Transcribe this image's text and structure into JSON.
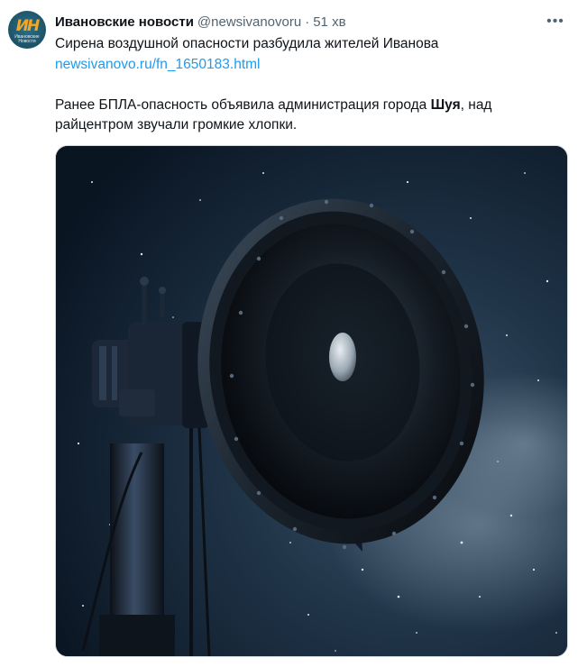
{
  "tweet": {
    "author_name": "Ивановские новости",
    "author_handle": "@newsivanovoru",
    "separator": "·",
    "time": "51 хв",
    "more_label": "•••",
    "avatar": {
      "logo_text": "ИН",
      "logo_sub": "Ивановские Новости"
    },
    "text": {
      "line1": "Сирена воздушной опасности разбудила жителей Иванова",
      "link": "newsivanovo.ru/fn_1650183.html",
      "para2_before": "Ранее БПЛА-опасность объявила администрация города ",
      "para2_bold": "Шуя",
      "para2_after": ", над райцентром звучали громкие хлопки."
    },
    "media": {
      "description_icon": "siren-loudspeaker-image"
    }
  },
  "colors": {
    "text": "#0f1419",
    "secondary": "#536471",
    "link": "#1d9bf0",
    "avatar_bg": "#1d5266",
    "avatar_logo": "#f5a623"
  }
}
